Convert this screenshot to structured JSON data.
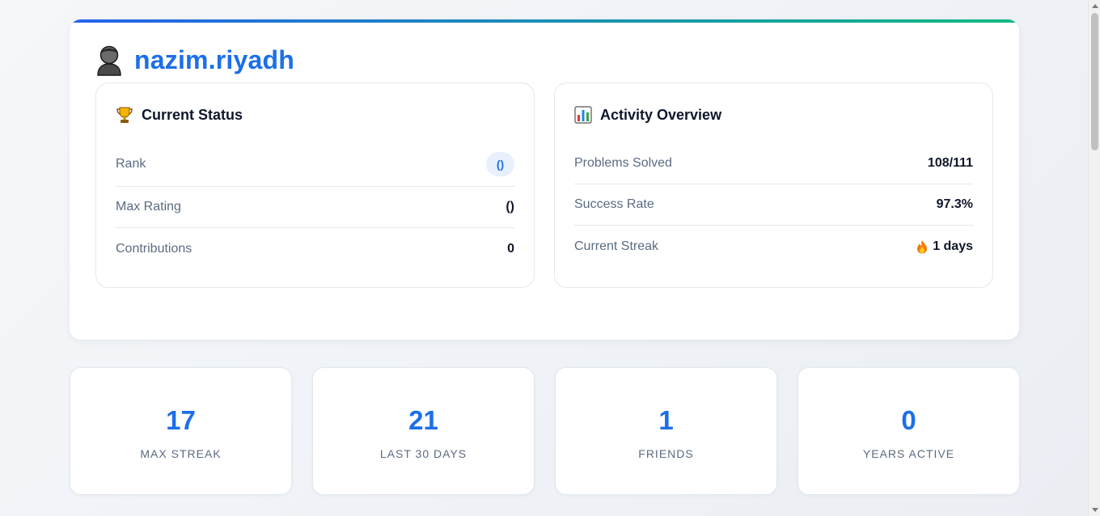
{
  "profile": {
    "username": "nazim.riyadh",
    "avatar_icon": "user-icon"
  },
  "status": {
    "title": "Current Status",
    "icon": "trophy-icon",
    "rows": [
      {
        "label": "Rank",
        "value": "()"
      },
      {
        "label": "Max Rating",
        "value": "()"
      },
      {
        "label": "Contributions",
        "value": "0"
      }
    ]
  },
  "activity": {
    "title": "Activity Overview",
    "icon": "bar-chart-icon",
    "rows": [
      {
        "label": "Problems Solved",
        "value": "108/111"
      },
      {
        "label": "Success Rate",
        "value": "97.3%"
      },
      {
        "label": "Current Streak",
        "value": "1 days",
        "icon": "fire-icon"
      }
    ]
  },
  "stats": [
    {
      "value": "17",
      "label": "MAX STREAK"
    },
    {
      "value": "21",
      "label": "LAST 30 DAYS"
    },
    {
      "value": "1",
      "label": "FRIENDS"
    },
    {
      "value": "0",
      "label": "YEARS ACTIVE"
    }
  ],
  "colors": {
    "accent": "#1d6fe8",
    "gradient_start": "#2563eb",
    "gradient_end": "#10b981",
    "muted_text": "#5b6b82"
  }
}
